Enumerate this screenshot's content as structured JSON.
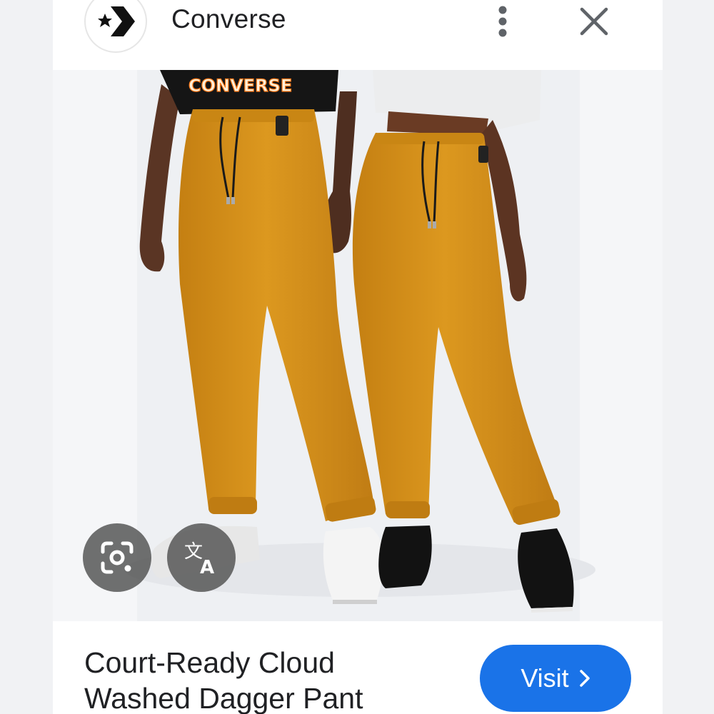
{
  "header": {
    "site_name": "Converse",
    "logo_icon": "converse-star-chevron-logo",
    "more_icon": "more-vert-icon",
    "close_icon": "close-icon"
  },
  "image": {
    "shirt_print": "CONVERSE",
    "overlay_buttons": [
      {
        "name": "lens-icon"
      },
      {
        "name": "translate-icon"
      }
    ]
  },
  "product": {
    "title_line1": "Court-Ready Cloud",
    "title_line2": "Washed Dagger Pant"
  },
  "visit": {
    "label": "Visit",
    "icon": "chevron-right-icon"
  },
  "colors": {
    "accent": "#1a73e8",
    "pant": "#d68f1c",
    "overlay": "#505050"
  }
}
